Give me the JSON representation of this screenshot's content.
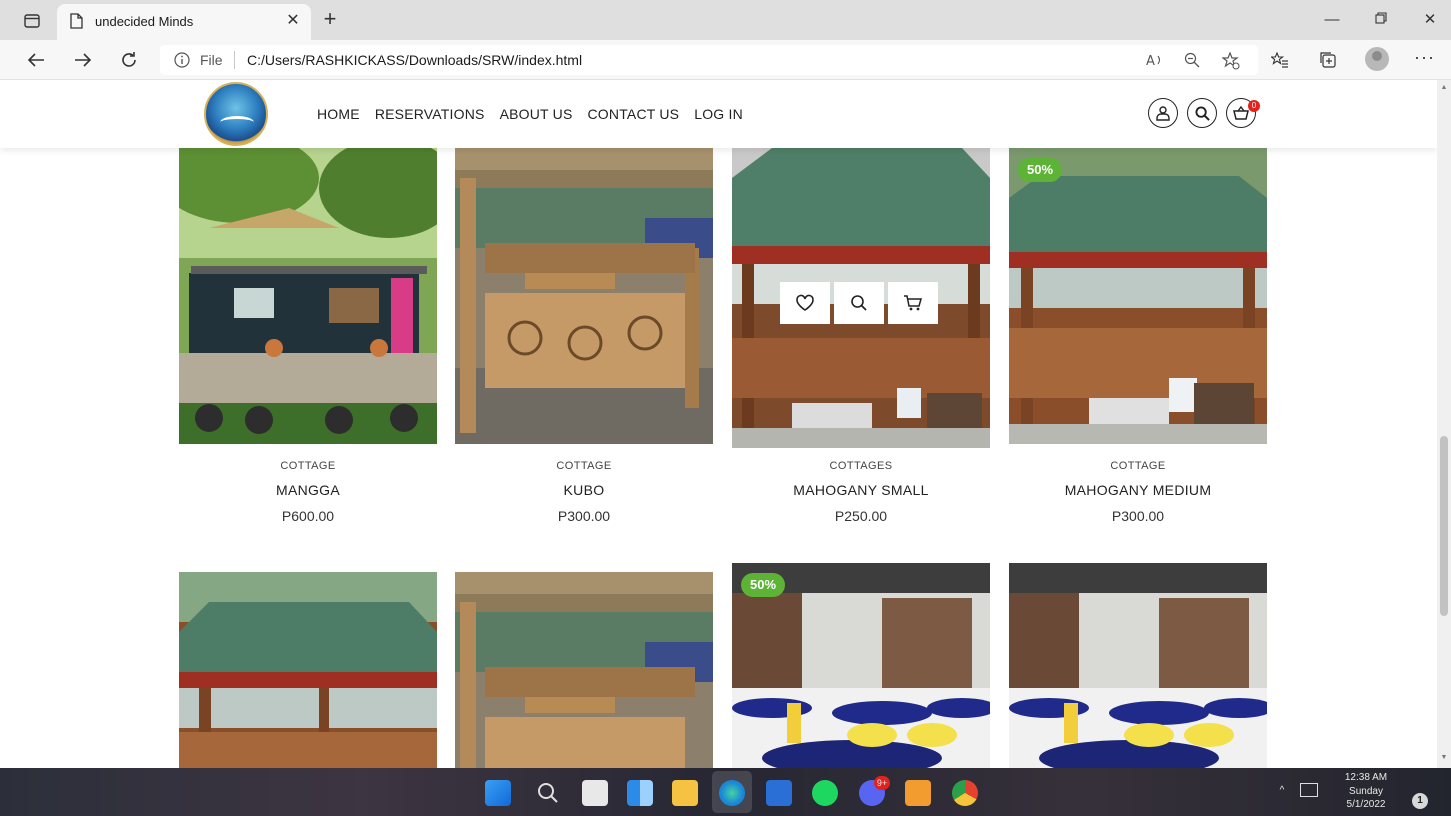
{
  "browser": {
    "tab_title": "undecided Minds",
    "url_prefix": "File",
    "url": "C:/Users/RASHKICKASS/Downloads/SRW/index.html"
  },
  "site": {
    "nav": [
      "HOME",
      "RESERVATIONS",
      "ABOUT US",
      "CONTACT US",
      "LOG IN"
    ],
    "cart_count": "0"
  },
  "products": [
    {
      "category": "COTTAGE",
      "name": "MANGGA",
      "price": "P600.00",
      "badge": "",
      "image": "garden-hut-photo"
    },
    {
      "category": "COTTAGE",
      "name": "KUBO",
      "price": "P300.00",
      "badge": "",
      "image": "bamboo-kubo-photo"
    },
    {
      "category": "COTTAGES",
      "name": "MAHOGANY SMALL",
      "price": "P250.00",
      "badge": "",
      "image": "mahogany-cottage-photo"
    },
    {
      "category": "COTTAGE",
      "name": "MAHOGANY MEDIUM",
      "price": "P300.00",
      "badge": "50%",
      "image": "mahogany-cottage-photo"
    },
    {
      "category": "",
      "name": "",
      "price": "",
      "badge": "",
      "image": "mahogany-cottage-photo"
    },
    {
      "category": "",
      "name": "",
      "price": "",
      "badge": "",
      "image": "bamboo-kubo-photo"
    },
    {
      "category": "",
      "name": "",
      "price": "",
      "badge": "50%",
      "image": "function-hall-photo"
    },
    {
      "category": "",
      "name": "",
      "price": "",
      "badge": "",
      "image": "function-hall-photo"
    }
  ],
  "taskbar": {
    "discord_badge": "9+",
    "clock_time": "12:38 AM",
    "clock_day": "Sunday",
    "clock_date": "5/1/2022",
    "notif_count": "1"
  }
}
